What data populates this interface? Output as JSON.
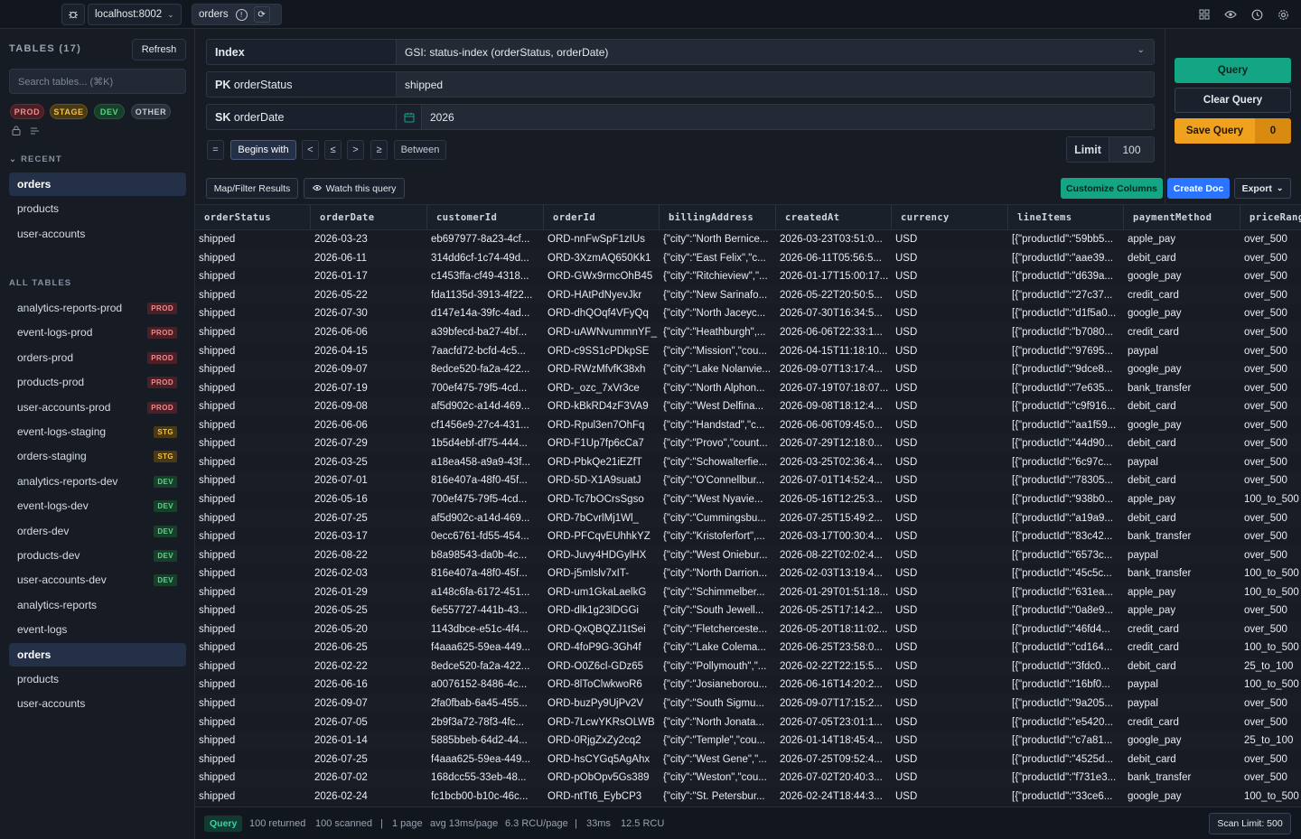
{
  "topbar": {
    "host": "localhost:8002",
    "tab_label": "orders"
  },
  "sidebar": {
    "tables_title": "TABLES (17)",
    "refresh_label": "Refresh",
    "search_placeholder": "Search tables... (⌘K)",
    "env_filters": [
      "PROD",
      "STAGE",
      "DEV",
      "OTHER"
    ],
    "recent_label": "RECENT",
    "recent": [
      "orders",
      "products",
      "user-accounts"
    ],
    "all_label": "ALL TABLES",
    "tables": [
      {
        "name": "analytics-reports-prod",
        "badge": "PROD",
        "kind": "prod"
      },
      {
        "name": "event-logs-prod",
        "badge": "PROD",
        "kind": "prod"
      },
      {
        "name": "orders-prod",
        "badge": "PROD",
        "kind": "prod"
      },
      {
        "name": "products-prod",
        "badge": "PROD",
        "kind": "prod"
      },
      {
        "name": "user-accounts-prod",
        "badge": "PROD",
        "kind": "prod"
      },
      {
        "name": "event-logs-staging",
        "badge": "STG",
        "kind": "stg"
      },
      {
        "name": "orders-staging",
        "badge": "STG",
        "kind": "stg"
      },
      {
        "name": "analytics-reports-dev",
        "badge": "DEV",
        "kind": "dev"
      },
      {
        "name": "event-logs-dev",
        "badge": "DEV",
        "kind": "dev"
      },
      {
        "name": "orders-dev",
        "badge": "DEV",
        "kind": "dev"
      },
      {
        "name": "products-dev",
        "badge": "DEV",
        "kind": "dev"
      },
      {
        "name": "user-accounts-dev",
        "badge": "DEV",
        "kind": "dev"
      },
      {
        "name": "analytics-reports",
        "badge": "",
        "kind": ""
      },
      {
        "name": "event-logs",
        "badge": "",
        "kind": ""
      },
      {
        "name": "orders",
        "badge": "",
        "kind": "",
        "active": true
      },
      {
        "name": "products",
        "badge": "",
        "kind": ""
      },
      {
        "name": "user-accounts",
        "badge": "",
        "kind": ""
      }
    ]
  },
  "query": {
    "index_label": "Index",
    "index_value": "GSI: status-index (orderStatus, orderDate)",
    "pk_prefix": "PK",
    "pk_name": "orderStatus",
    "pk_value": "shipped",
    "sk_prefix": "SK",
    "sk_name": "orderDate",
    "sk_value": "2026",
    "operators": [
      "=",
      "Begins with",
      "<",
      "≤",
      ">",
      "≥",
      "Between"
    ],
    "limit_label": "Limit",
    "limit_value": "100",
    "query_button": "Query",
    "clear_button": "Clear Query",
    "save_button": "Save Query",
    "save_count": "0"
  },
  "toolbar": {
    "map_filter": "Map/Filter Results",
    "watch": "Watch this query",
    "customize": "Customize Columns",
    "create_doc": "Create Doc",
    "export": "Export"
  },
  "colors": {
    "accent_green": "#14a585",
    "accent_blue": "#2b74ff",
    "save_orange": "#f0a21e"
  },
  "table": {
    "columns": [
      "orderStatus",
      "orderDate",
      "customerId",
      "orderId",
      "billingAddress",
      "createdAt",
      "currency",
      "lineItems",
      "paymentMethod",
      "priceRange"
    ],
    "rows": [
      [
        "shipped",
        "2026-03-23",
        "eb697977-8a23-4cf...",
        "ORD-nnFwSpF1zIUs",
        "{\"city\":\"North Bernice...",
        "2026-03-23T03:51:0...",
        "USD",
        "[{\"productId\":\"59bb5...",
        "apple_pay",
        "over_500"
      ],
      [
        "shipped",
        "2026-06-11",
        "314dd6cf-1c74-49d...",
        "ORD-3XzmAQ650Kk1",
        "{\"city\":\"East Felix\",\"c...",
        "2026-06-11T05:56:5...",
        "USD",
        "[{\"productId\":\"aae39...",
        "debit_card",
        "over_500"
      ],
      [
        "shipped",
        "2026-01-17",
        "c1453ffa-cf49-4318...",
        "ORD-GWx9rmcOhB45",
        "{\"city\":\"Ritchieview\",\"...",
        "2026-01-17T15:00:17...",
        "USD",
        "[{\"productId\":\"d639a...",
        "google_pay",
        "over_500"
      ],
      [
        "shipped",
        "2026-05-22",
        "fda1135d-3913-4f22...",
        "ORD-HAtPdNyevJkr",
        "{\"city\":\"New Sarinafo...",
        "2026-05-22T20:50:5...",
        "USD",
        "[{\"productId\":\"27c37...",
        "credit_card",
        "over_500"
      ],
      [
        "shipped",
        "2026-07-30",
        "d147e14a-39fc-4ad...",
        "ORD-dhQOqf4VFyQq",
        "{\"city\":\"North Jaceyc...",
        "2026-07-30T16:34:5...",
        "USD",
        "[{\"productId\":\"d1f5a0...",
        "google_pay",
        "over_500"
      ],
      [
        "shipped",
        "2026-06-06",
        "a39bfecd-ba27-4bf...",
        "ORD-uAWNvummnYF_",
        "{\"city\":\"Heathburgh\",...",
        "2026-06-06T22:33:1...",
        "USD",
        "[{\"productId\":\"b7080...",
        "credit_card",
        "over_500"
      ],
      [
        "shipped",
        "2026-04-15",
        "7aacfd72-bcfd-4c5...",
        "ORD-c9SS1cPDkpSE",
        "{\"city\":\"Mission\",\"cou...",
        "2026-04-15T11:18:10...",
        "USD",
        "[{\"productId\":\"97695...",
        "paypal",
        "over_500"
      ],
      [
        "shipped",
        "2026-09-07",
        "8edce520-fa2a-422...",
        "ORD-RWzMfvfK38xh",
        "{\"city\":\"Lake Nolanvie...",
        "2026-09-07T13:17:4...",
        "USD",
        "[{\"productId\":\"9dce8...",
        "google_pay",
        "over_500"
      ],
      [
        "shipped",
        "2026-07-19",
        "700ef475-79f5-4cd...",
        "ORD-_ozc_7xVr3ce",
        "{\"city\":\"North Alphon...",
        "2026-07-19T07:18:07...",
        "USD",
        "[{\"productId\":\"7e635...",
        "bank_transfer",
        "over_500"
      ],
      [
        "shipped",
        "2026-09-08",
        "af5d902c-a14d-469...",
        "ORD-kBkRD4zF3VA9",
        "{\"city\":\"West Delfina...",
        "2026-09-08T18:12:4...",
        "USD",
        "[{\"productId\":\"c9f916...",
        "debit_card",
        "over_500"
      ],
      [
        "shipped",
        "2026-06-06",
        "cf1456e9-27c4-431...",
        "ORD-Rpul3en7OhFq",
        "{\"city\":\"Handstad\",\"c...",
        "2026-06-06T09:45:0...",
        "USD",
        "[{\"productId\":\"aa1f59...",
        "google_pay",
        "over_500"
      ],
      [
        "shipped",
        "2026-07-29",
        "1b5d4ebf-df75-444...",
        "ORD-F1Up7fp6cCa7",
        "{\"city\":\"Provo\",\"count...",
        "2026-07-29T12:18:0...",
        "USD",
        "[{\"productId\":\"44d90...",
        "debit_card",
        "over_500"
      ],
      [
        "shipped",
        "2026-03-25",
        "a18ea458-a9a9-43f...",
        "ORD-PbkQe21iEZfT",
        "{\"city\":\"Schowalterfie...",
        "2026-03-25T02:36:4...",
        "USD",
        "[{\"productId\":\"6c97c...",
        "paypal",
        "over_500"
      ],
      [
        "shipped",
        "2026-07-01",
        "816e407a-48f0-45f...",
        "ORD-5D-X1A9suatJ",
        "{\"city\":\"O'Connellbur...",
        "2026-07-01T14:52:4...",
        "USD",
        "[{\"productId\":\"78305...",
        "debit_card",
        "over_500"
      ],
      [
        "shipped",
        "2026-05-16",
        "700ef475-79f5-4cd...",
        "ORD-Tc7bOCrsSgso",
        "{\"city\":\"West Nyavie...",
        "2026-05-16T12:25:3...",
        "USD",
        "[{\"productId\":\"938b0...",
        "apple_pay",
        "100_to_500"
      ],
      [
        "shipped",
        "2026-07-25",
        "af5d902c-a14d-469...",
        "ORD-7bCvrlMj1Wl_",
        "{\"city\":\"Cummingsbu...",
        "2026-07-25T15:49:2...",
        "USD",
        "[{\"productId\":\"a19a9...",
        "debit_card",
        "over_500"
      ],
      [
        "shipped",
        "2026-03-17",
        "0ecc6761-fd55-454...",
        "ORD-PFCqvEUhhkYZ",
        "{\"city\":\"Kristoferfort\",...",
        "2026-03-17T00:30:4...",
        "USD",
        "[{\"productId\":\"83c42...",
        "bank_transfer",
        "over_500"
      ],
      [
        "shipped",
        "2026-08-22",
        "b8a98543-da0b-4c...",
        "ORD-Juvy4HDGylHX",
        "{\"city\":\"West Oniebur...",
        "2026-08-22T02:02:4...",
        "USD",
        "[{\"productId\":\"6573c...",
        "paypal",
        "over_500"
      ],
      [
        "shipped",
        "2026-02-03",
        "816e407a-48f0-45f...",
        "ORD-j5mlslv7xIT-",
        "{\"city\":\"North Darrion...",
        "2026-02-03T13:19:4...",
        "USD",
        "[{\"productId\":\"45c5c...",
        "bank_transfer",
        "100_to_500"
      ],
      [
        "shipped",
        "2026-01-29",
        "a148c6fa-6172-451...",
        "ORD-um1GkaLaelkG",
        "{\"city\":\"Schimmelber...",
        "2026-01-29T01:51:18...",
        "USD",
        "[{\"productId\":\"631ea...",
        "apple_pay",
        "100_to_500"
      ],
      [
        "shipped",
        "2026-05-25",
        "6e557727-441b-43...",
        "ORD-dlk1g23lDGGi",
        "{\"city\":\"South Jewell...",
        "2026-05-25T17:14:2...",
        "USD",
        "[{\"productId\":\"0a8e9...",
        "apple_pay",
        "over_500"
      ],
      [
        "shipped",
        "2026-05-20",
        "1143dbce-e51c-4f4...",
        "ORD-QxQBQZJ1tSei",
        "{\"city\":\"Fletcherceste...",
        "2026-05-20T18:11:02...",
        "USD",
        "[{\"productId\":\"46fd4...",
        "credit_card",
        "over_500"
      ],
      [
        "shipped",
        "2026-06-25",
        "f4aaa625-59ea-449...",
        "ORD-4foP9G-3Gh4f",
        "{\"city\":\"Lake Colema...",
        "2026-06-25T23:58:0...",
        "USD",
        "[{\"productId\":\"cd164...",
        "credit_card",
        "100_to_500"
      ],
      [
        "shipped",
        "2026-02-22",
        "8edce520-fa2a-422...",
        "ORD-O0Z6cl-GDz65",
        "{\"city\":\"Pollymouth\",\"...",
        "2026-02-22T22:15:5...",
        "USD",
        "[{\"productId\":\"3fdc0...",
        "debit_card",
        "25_to_100"
      ],
      [
        "shipped",
        "2026-06-16",
        "a0076152-8486-4c...",
        "ORD-8lToClwkwoR6",
        "{\"city\":\"Josianeborou...",
        "2026-06-16T14:20:2...",
        "USD",
        "[{\"productId\":\"16bf0...",
        "paypal",
        "100_to_500"
      ],
      [
        "shipped",
        "2026-09-07",
        "2fa0fbab-6a45-455...",
        "ORD-buzPy9UjPv2V",
        "{\"city\":\"South Sigmu...",
        "2026-09-07T17:15:2...",
        "USD",
        "[{\"productId\":\"9a205...",
        "paypal",
        "over_500"
      ],
      [
        "shipped",
        "2026-07-05",
        "2b9f3a72-78f3-4fc...",
        "ORD-7LcwYKRsOLWB",
        "{\"city\":\"North Jonata...",
        "2026-07-05T23:01:1...",
        "USD",
        "[{\"productId\":\"e5420...",
        "credit_card",
        "over_500"
      ],
      [
        "shipped",
        "2026-01-14",
        "5885bbeb-64d2-44...",
        "ORD-0RjgZxZy2cq2",
        "{\"city\":\"Temple\",\"cou...",
        "2026-01-14T18:45:4...",
        "USD",
        "[{\"productId\":\"c7a81...",
        "google_pay",
        "25_to_100"
      ],
      [
        "shipped",
        "2026-07-25",
        "f4aaa625-59ea-449...",
        "ORD-hsCYGq5AgAhx",
        "{\"city\":\"West Gene\",\"...",
        "2026-07-25T09:52:4...",
        "USD",
        "[{\"productId\":\"4525d...",
        "debit_card",
        "over_500"
      ],
      [
        "shipped",
        "2026-07-02",
        "168dcc55-33eb-48...",
        "ORD-pObOpv5Gs389",
        "{\"city\":\"Weston\",\"cou...",
        "2026-07-02T20:40:3...",
        "USD",
        "[{\"productId\":\"f731e3...",
        "bank_transfer",
        "over_500"
      ],
      [
        "shipped",
        "2026-02-24",
        "fc1bcb00-b10c-46c...",
        "ORD-ntTt6_EybCP3",
        "{\"city\":\"St. Petersbur...",
        "2026-02-24T18:44:3...",
        "USD",
        "[{\"productId\":\"33ce6...",
        "google_pay",
        "100_to_500"
      ]
    ]
  },
  "status": {
    "mode": "Query",
    "returned": "100 returned",
    "scanned": "100 scanned",
    "pages": "1 page",
    "avg": "avg 13ms/page",
    "rcu_page": "6.3 RCU/page",
    "time": "33ms",
    "rcu": "12.5 RCU",
    "scan_limit": "Scan Limit: 500"
  }
}
